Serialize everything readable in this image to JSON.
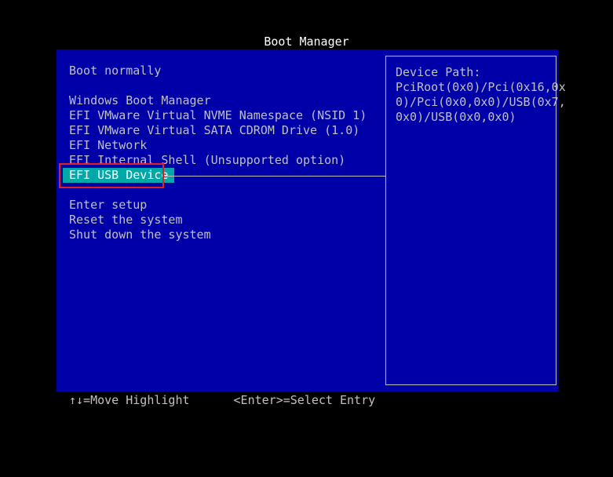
{
  "title": "Boot Manager",
  "menu": {
    "items": [
      "Boot normally",
      "",
      "Windows Boot Manager",
      "EFI VMware Virtual NVME Namespace (NSID 1)",
      "EFI VMware Virtual SATA CDROM Drive (1.0)",
      "EFI Network",
      "EFI Internal Shell (Unsupported option)",
      "EFI USB Device",
      "",
      "Enter setup",
      "Reset the system",
      "Shut down the system"
    ],
    "selected": "EFI USB Device"
  },
  "info": {
    "heading": "Device Path:",
    "lines": [
      "PciRoot(0x0)/Pci(0x16,0x",
      "0)/Pci(0x0,0x0)/USB(0x7,",
      "0x0)/USB(0x0,0x0)"
    ]
  },
  "footer": {
    "move_hint": "↑↓=Move Highlight",
    "select_hint": "<Enter>=Select Entry"
  },
  "colors": {
    "background": "#000000",
    "panel": "#0000a8",
    "text": "#c0c0c0",
    "selection": "#00a8a8",
    "annotation": "#e02020"
  }
}
